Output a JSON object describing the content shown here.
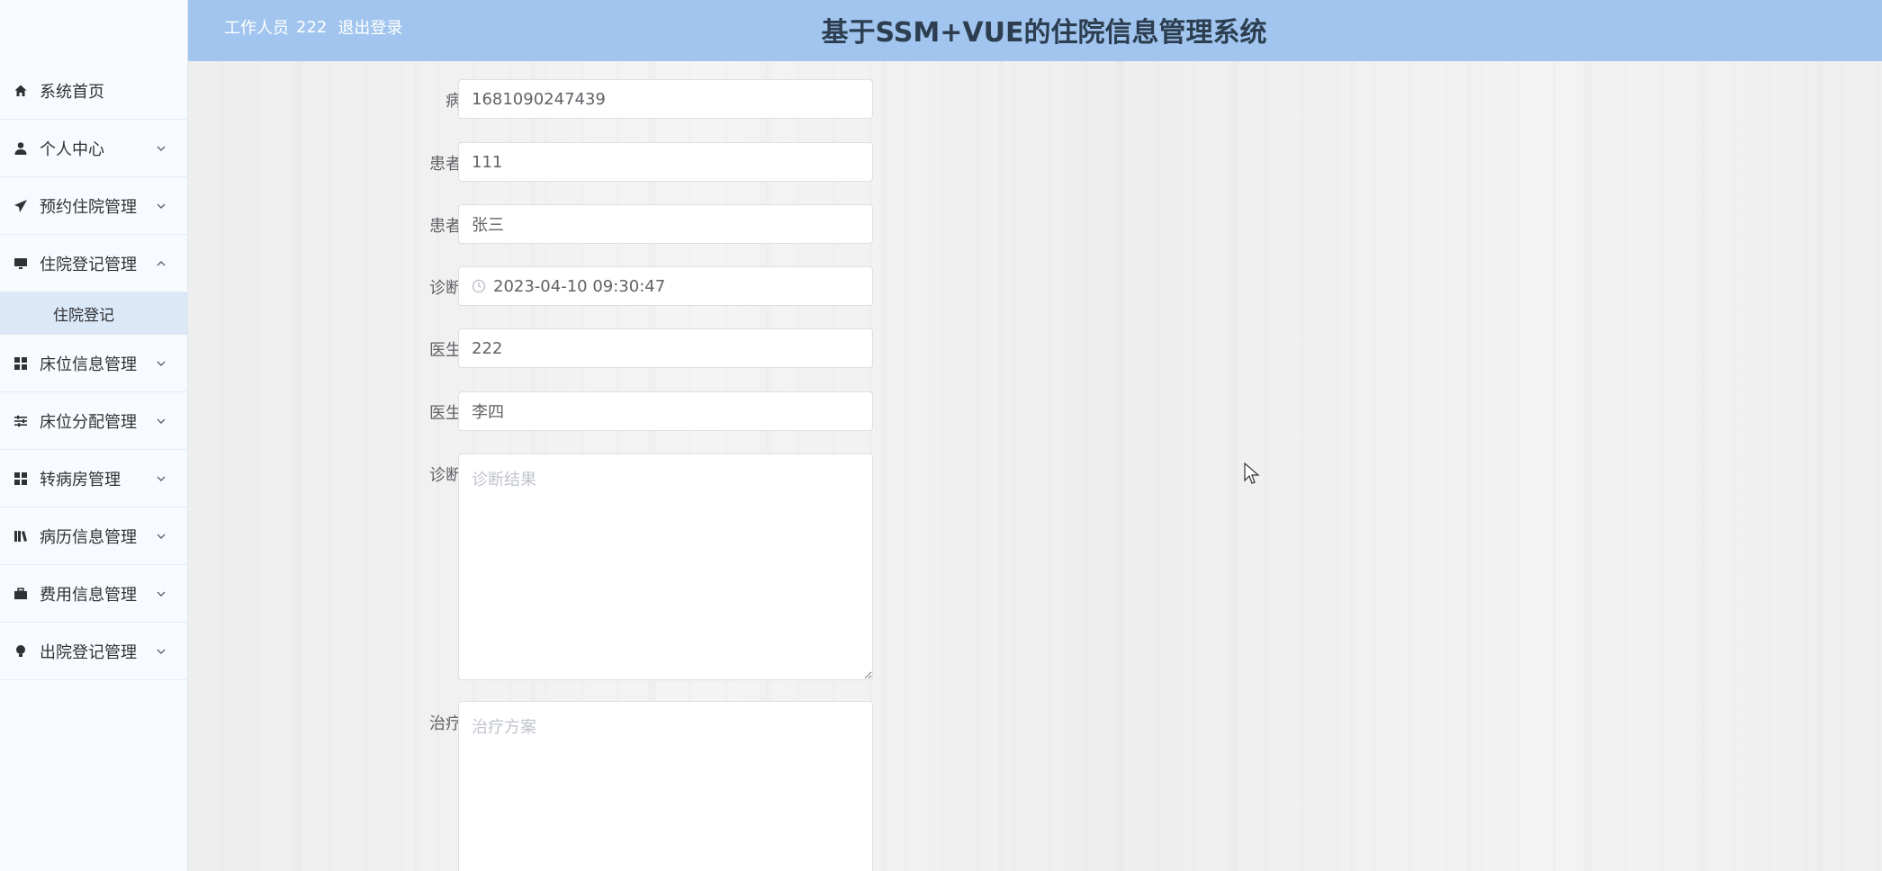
{
  "header": {
    "role_label": "工作人员",
    "username": "222",
    "logout_label": "退出登录",
    "title": "基于SSM+VUE的住院信息管理系统"
  },
  "sidebar": {
    "items": [
      {
        "label": "系统首页",
        "icon": "home-icon"
      },
      {
        "label": "个人中心",
        "icon": "user-icon"
      },
      {
        "label": "预约住院管理",
        "icon": "send-icon"
      },
      {
        "label": "住院登记管理",
        "icon": "monitor-icon"
      },
      {
        "label": "床位信息管理",
        "icon": "grid-icon"
      },
      {
        "label": "床位分配管理",
        "icon": "sliders-icon"
      },
      {
        "label": "转病房管理",
        "icon": "grid-icon"
      },
      {
        "label": "病历信息管理",
        "icon": "books-icon"
      },
      {
        "label": "费用信息管理",
        "icon": "briefcase-icon"
      },
      {
        "label": "出院登记管理",
        "icon": "bulb-icon"
      }
    ],
    "submenu_active": "住院登记"
  },
  "form": {
    "record_no": {
      "label": "病历号",
      "value": "1681090247439"
    },
    "patient_account": {
      "label": "患者账号",
      "value": "111"
    },
    "patient_name": {
      "label": "患者姓名",
      "value": "张三"
    },
    "diagnosis_time": {
      "label": "诊断时间",
      "value": "2023-04-10 09:30:47"
    },
    "doctor_id": {
      "label": "医生工号",
      "value": "222"
    },
    "doctor_name": {
      "label": "医生姓名",
      "value": "李四"
    },
    "diagnosis_result": {
      "label": "诊断结果",
      "placeholder": "诊断结果"
    },
    "treatment_plan": {
      "label": "治疗方案",
      "placeholder": "治疗方案"
    }
  },
  "colors": {
    "header_bg": "#a1c5ee",
    "sidebar_bg": "#f7fbff",
    "submenu_active_bg": "#dbe8f8",
    "title_text": "#2c3e50"
  }
}
